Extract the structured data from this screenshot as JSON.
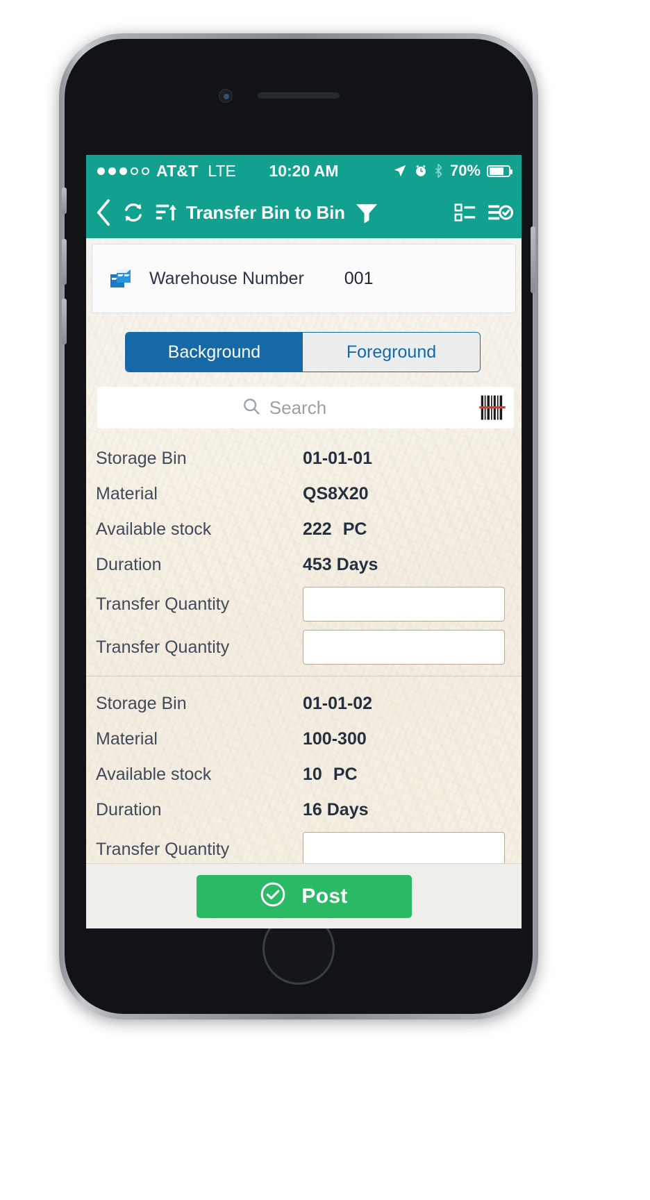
{
  "status_bar": {
    "carrier": "AT&T",
    "network_type": "LTE",
    "time": "10:20 AM",
    "battery_percent": "70%",
    "signal_dots_filled": 3,
    "signal_dots_total": 5,
    "icons": [
      "location-arrow-icon",
      "alarm-clock-icon",
      "bluetooth-icon",
      "battery-icon"
    ],
    "bar_color": "#12a08f"
  },
  "nav_bar": {
    "back_label": "Back",
    "title": "Transfer Bin to Bin",
    "icons": {
      "back": "chevron-left-icon",
      "refresh": "sync-refresh-icon",
      "sort": "sort-ascending-icon",
      "filter": "filter-funnel-icon",
      "list": "list-view-icon",
      "checklist": "checklist-icon"
    },
    "bar_color": "#12a08f"
  },
  "warehouse": {
    "icon": "warehouse-boxes-icon",
    "label": "Warehouse Number",
    "value": "001",
    "icon_color": "#1a7bc4"
  },
  "segmented_control": {
    "options": [
      "Background",
      "Foreground"
    ],
    "selected": "Background",
    "active_color": "#1469a6"
  },
  "search": {
    "placeholder": "Search",
    "value": "",
    "icon": "search-icon",
    "scan_icon": "barcode-scanner-icon"
  },
  "list": {
    "labels": {
      "storage_bin": "Storage Bin",
      "material": "Material",
      "available_stock": "Available stock",
      "duration": "Duration",
      "transfer_quantity": "Transfer Quantity"
    },
    "groups": [
      {
        "storage_bin": "01-01-01",
        "material": "QS8X20",
        "available_stock": "222",
        "available_stock_unit": "PC",
        "duration": "453 Days",
        "transfer_quantity_1": "",
        "transfer_quantity_2": ""
      },
      {
        "storage_bin": "01-01-02",
        "material": "100-300",
        "available_stock": "10",
        "available_stock_unit": "PC",
        "duration": "16 Days",
        "transfer_quantity_1": "",
        "transfer_quantity_2": ""
      }
    ]
  },
  "footer": {
    "post_label": "Post",
    "post_icon": "check-circle-icon",
    "post_color": "#2aba66"
  }
}
